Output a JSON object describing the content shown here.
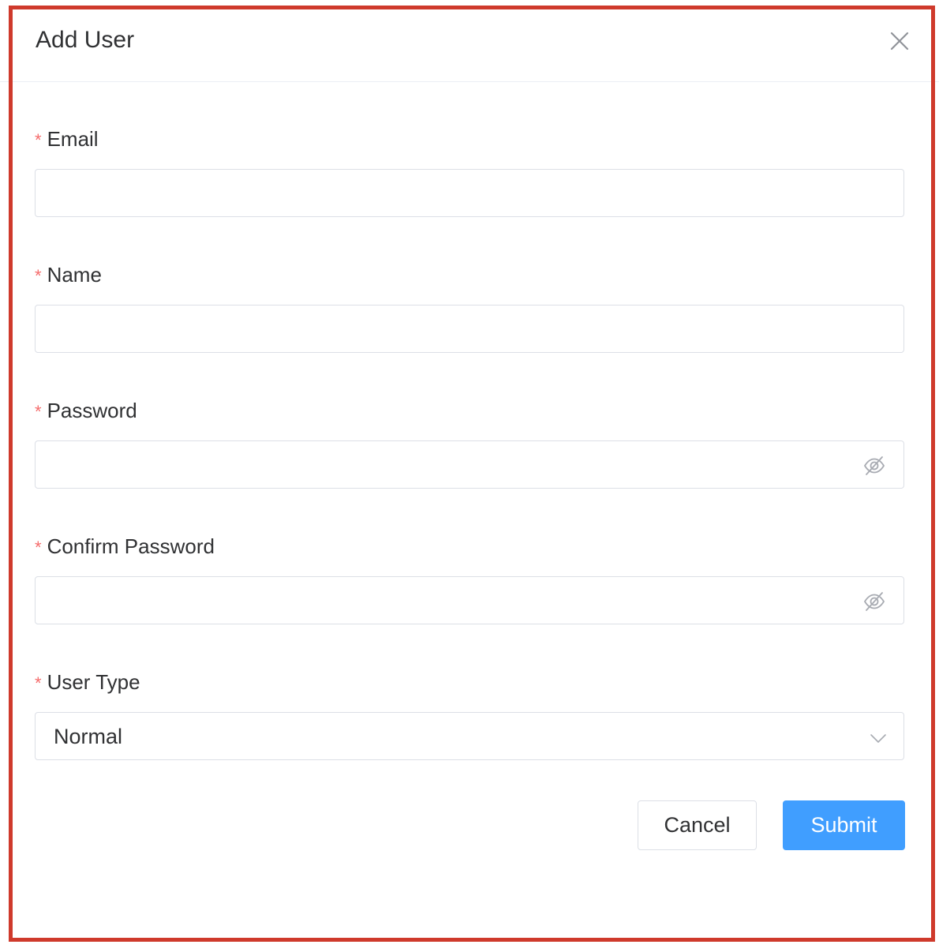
{
  "dialog": {
    "title": "Add User",
    "close_icon": "close-icon"
  },
  "form": {
    "required_mark": "*",
    "email": {
      "label": "Email",
      "value": "",
      "placeholder": ""
    },
    "name": {
      "label": "Name",
      "value": "",
      "placeholder": ""
    },
    "password": {
      "label": "Password",
      "value": "",
      "placeholder": "",
      "toggle_icon": "eye-off-icon"
    },
    "confirm_password": {
      "label": "Confirm Password",
      "value": "",
      "placeholder": "",
      "toggle_icon": "eye-off-icon"
    },
    "user_type": {
      "label": "User Type",
      "selected": "Normal",
      "icon": "chevron-down-icon"
    }
  },
  "actions": {
    "cancel_label": "Cancel",
    "submit_label": "Submit"
  },
  "colors": {
    "primary": "#409eff",
    "required": "#f56c6c",
    "border": "#dcdfe6",
    "highlight_frame": "#cf3a2c"
  }
}
